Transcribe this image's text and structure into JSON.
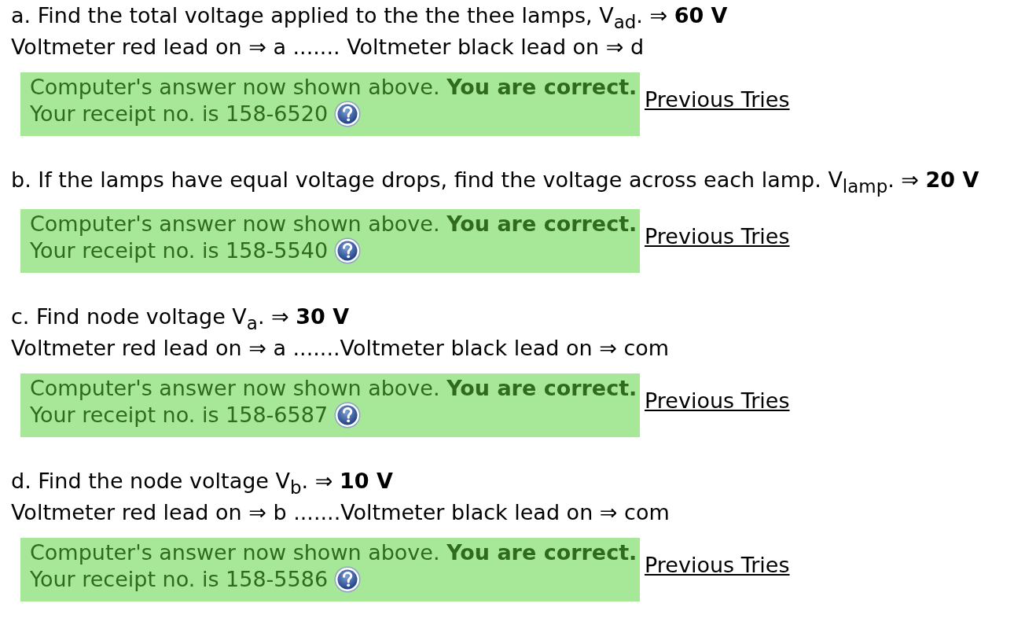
{
  "parts": [
    {
      "question": "a. Find the total voltage applied to the the thee lamps, V$_{ad}$. ⇒ **60 V**",
      "leads": "Voltmeter red lead on ⇒ a ....... Voltmeter black lead on ⇒ d",
      "feedback": {
        "correct": true,
        "message": "Computer's answer now shown above. **You are correct.**",
        "receipt": "Your receipt no. is 158-6520"
      },
      "link": "Previous Tries"
    },
    {
      "question": "b. If the lamps have equal voltage drops, find the voltage across each lamp. V$_{lamp}$. ⇒ **20 V**",
      "feedback": {
        "correct": true,
        "message": "Computer's answer now shown above. **You are correct.**",
        "receipt": "Your receipt no. is 158-5540"
      },
      "link": "Previous Tries"
    },
    {
      "question": "c. Find node voltage V$_{a}$. ⇒ **30 V**",
      "leads": "Voltmeter red lead on ⇒ a .......Voltmeter black lead on ⇒ com",
      "feedback": {
        "correct": true,
        "message": "Computer's answer now shown above. **You are correct.**",
        "receipt": "Your receipt no. is 158-6587"
      },
      "link": "Previous Tries"
    },
    {
      "question": "d. Find the node voltage V$_{b}$. ⇒ **10 V**",
      "leads": "Voltmeter red lead on ⇒ b .......Voltmeter black lead on ⇒ com",
      "feedback": {
        "correct": true,
        "message": "Computer's answer now shown above. **You are correct.**",
        "receipt": "Your receipt no. is 158-5586"
      },
      "link": "Previous Tries"
    }
  ]
}
